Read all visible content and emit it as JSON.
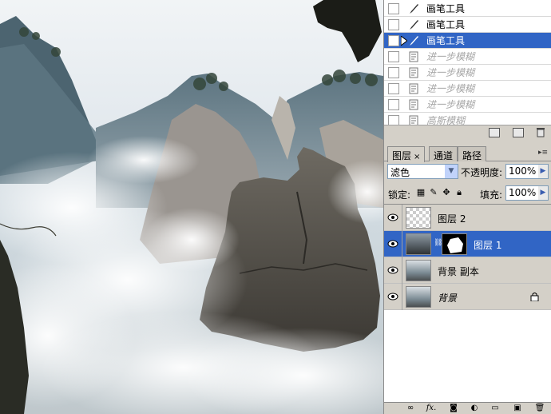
{
  "history": {
    "items": [
      {
        "label": "画笔工具",
        "state": "normal",
        "icon": "brush-icon"
      },
      {
        "label": "画笔工具",
        "state": "normal",
        "icon": "brush-icon"
      },
      {
        "label": "画笔工具",
        "state": "active",
        "icon": "brush-icon"
      },
      {
        "label": "进一步模糊",
        "state": "inactive",
        "icon": "filter-doc-icon"
      },
      {
        "label": "进一步模糊",
        "state": "inactive",
        "icon": "filter-doc-icon"
      },
      {
        "label": "进一步模糊",
        "state": "inactive",
        "icon": "filter-doc-icon"
      },
      {
        "label": "进一步模糊",
        "state": "inactive",
        "icon": "filter-doc-icon"
      },
      {
        "label": "高斯模糊",
        "state": "inactive",
        "icon": "filter-doc-icon"
      }
    ]
  },
  "layers_panel": {
    "tabs": [
      {
        "label": "图层",
        "close": "×"
      },
      {
        "label": "通道"
      },
      {
        "label": "路径"
      }
    ],
    "blend_mode": "滤色",
    "opacity_label": "不透明度:",
    "opacity_value": "100%",
    "lock_label": "锁定:",
    "fill_label": "填充:",
    "fill_value": "100%",
    "layers": [
      {
        "name": "图层 2",
        "visible": true,
        "active": false
      },
      {
        "name": "图层 1",
        "visible": true,
        "active": true
      },
      {
        "name": "背景 副本",
        "visible": true,
        "active": false
      },
      {
        "name": "背景",
        "visible": true,
        "active": false,
        "locked": true
      }
    ],
    "footer_fx": "fx."
  },
  "colors": {
    "selection": "#3165c5",
    "panel_bg": "#d4d0c8",
    "inactive_text": "#a7a7a7"
  }
}
